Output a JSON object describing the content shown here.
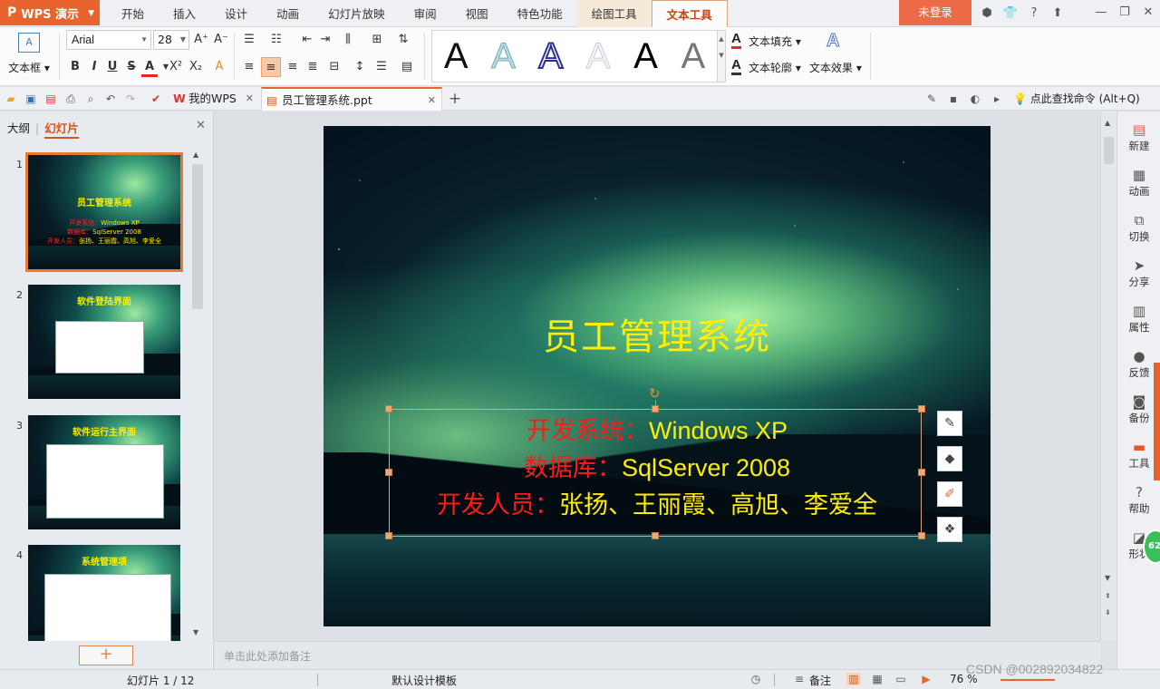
{
  "app": {
    "name": "WPS 演示",
    "logo_glyph": "P",
    "login_label": "未登录",
    "title_icons": [
      "⬢",
      "👕",
      "?",
      "⬆"
    ],
    "window_controls": [
      "—",
      "❐",
      "✕"
    ]
  },
  "menu": {
    "tabs": [
      "开始",
      "插入",
      "设计",
      "动画",
      "幻灯片放映",
      "审阅",
      "视图",
      "特色功能",
      "绘图工具",
      "文本工具"
    ],
    "active_tab": "文本工具"
  },
  "ribbon": {
    "textbox_label": "文本框",
    "font_name": "Arial",
    "font_size": "28",
    "grow_font": "A⁺",
    "shrink_font": "A⁻",
    "bold": "B",
    "italic": "I",
    "underline": "U",
    "strike": "S",
    "font_color": "A",
    "superscript": "X²",
    "subscript": "X₂",
    "clear_format": "A",
    "style_gallery": [
      "A",
      "A",
      "A",
      "A",
      "A",
      "A"
    ],
    "text_fill_label": "文本填充",
    "text_outline_label": "文本轮廓",
    "text_effect_label": "文本效果"
  },
  "quickbar": {
    "my_wps_label": "我的WPS",
    "document_tab": "员工管理系统.ppt",
    "new_tab": "+",
    "search_label": "点此查找命令 (Alt+Q)"
  },
  "left_panel": {
    "outline_tab": "大纲",
    "slides_tab": "幻灯片",
    "add_slide": "+",
    "thumbnails": [
      {
        "num": "1",
        "title": "员工管理系统",
        "lines": [
          [
            "开发系统：",
            "Windows XP"
          ],
          [
            "数据库：",
            "SqlServer 2008"
          ],
          [
            "开发人员：",
            "张扬、王丽霞、高旭、李爱全"
          ]
        ]
      },
      {
        "num": "2",
        "title": "软件登陆界面"
      },
      {
        "num": "3",
        "title": "软件运行主界面"
      },
      {
        "num": "4",
        "title": "系统管理项"
      }
    ]
  },
  "slide": {
    "title": "员工管理系统",
    "lines": [
      {
        "label": "开发系统：",
        "value": "Windows XP"
      },
      {
        "label": "数据库：",
        "value": "SqlServer 2008"
      },
      {
        "label": "开发人员：",
        "value": "张扬、王丽霞、高旭、李爱全"
      }
    ],
    "colors": {
      "title": "#ffee00",
      "label": "#ff1a1a",
      "value": "#ffee00"
    }
  },
  "notes_placeholder": "单击此处添加备注",
  "right_bar": [
    {
      "icon": "new-icon",
      "label": "新建"
    },
    {
      "icon": "animation-icon",
      "label": "动画"
    },
    {
      "icon": "switch-icon",
      "label": "切换"
    },
    {
      "icon": "share-icon",
      "label": "分享"
    },
    {
      "icon": "properties-icon",
      "label": "属性"
    },
    {
      "icon": "feedback-icon",
      "label": "反馈"
    },
    {
      "icon": "backup-icon",
      "label": "备份"
    },
    {
      "icon": "tools-icon",
      "label": "工具"
    },
    {
      "icon": "help-icon",
      "label": "帮助"
    },
    {
      "icon": "shape-icon",
      "label": "形状"
    }
  ],
  "right_badge": "62",
  "status": {
    "slide_counter": "幻灯片 1 / 12",
    "template": "默认设计模板",
    "notes_label": "备注",
    "zoom": "76 %"
  },
  "watermark": "CSDN @002892034822"
}
